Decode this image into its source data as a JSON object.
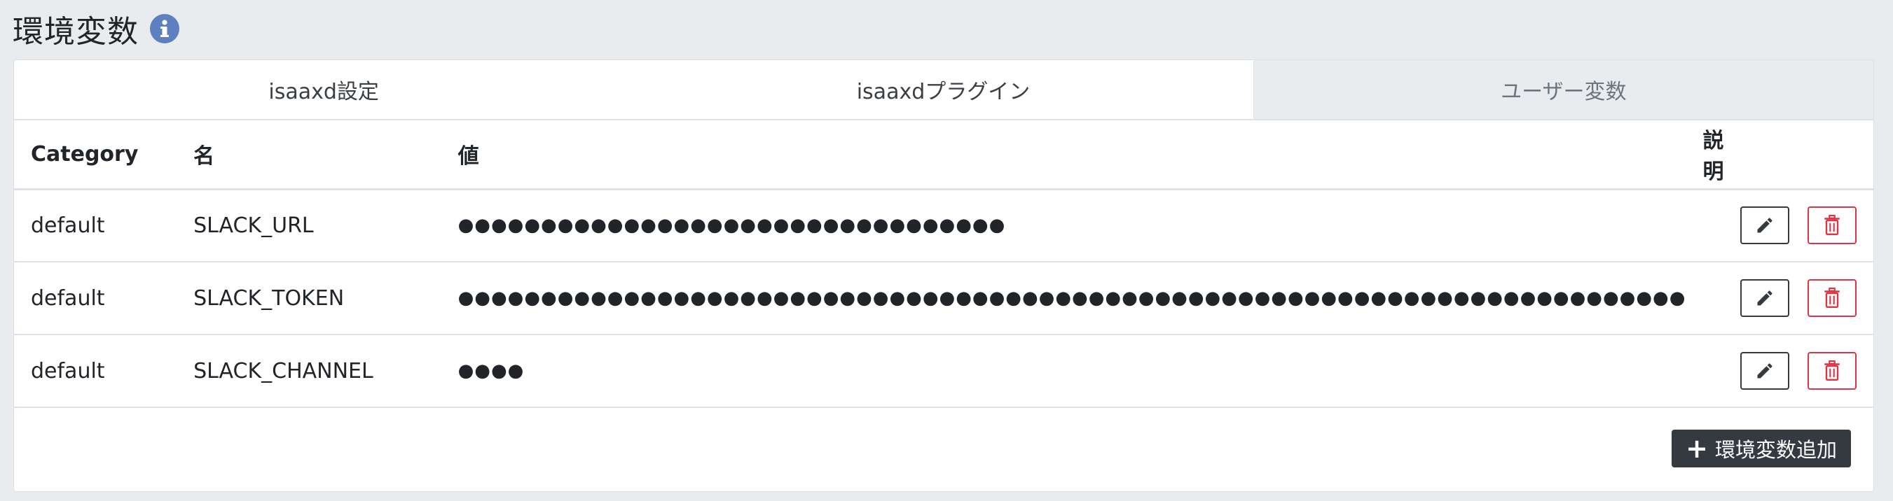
{
  "page": {
    "title": "環境変数"
  },
  "icons": {
    "info": "info-icon",
    "edit": "pencil-icon",
    "delete": "trash-icon",
    "add": "plus-icon"
  },
  "colors": {
    "info": "#5e7fc0",
    "delete": "#dc3545",
    "dark": "#343a40"
  },
  "tabs": [
    {
      "label": "isaaxd設定",
      "active": false
    },
    {
      "label": "isaaxdプラグイン",
      "active": false
    },
    {
      "label": "ユーザー変数",
      "active": true
    }
  ],
  "table": {
    "headers": {
      "category": "Category",
      "name": "名",
      "value": "値",
      "description": "説明"
    },
    "rows": [
      {
        "category": "default",
        "name": "SLACK_URL",
        "value": "●●●●●●●●●●●●●●●●●●●●●●●●●●●●●●●●●",
        "description": ""
      },
      {
        "category": "default",
        "name": "SLACK_TOKEN",
        "value": "●●●●●●●●●●●●●●●●●●●●●●●●●●●●●●●●●●●●●●●●●●●●●●●●●●●●●●●●●●●●●●●●●●●●●●●●●●",
        "description": ""
      },
      {
        "category": "default",
        "name": "SLACK_CHANNEL",
        "value": "●●●●",
        "description": ""
      }
    ]
  },
  "actions": {
    "add_label": "環境変数追加"
  }
}
